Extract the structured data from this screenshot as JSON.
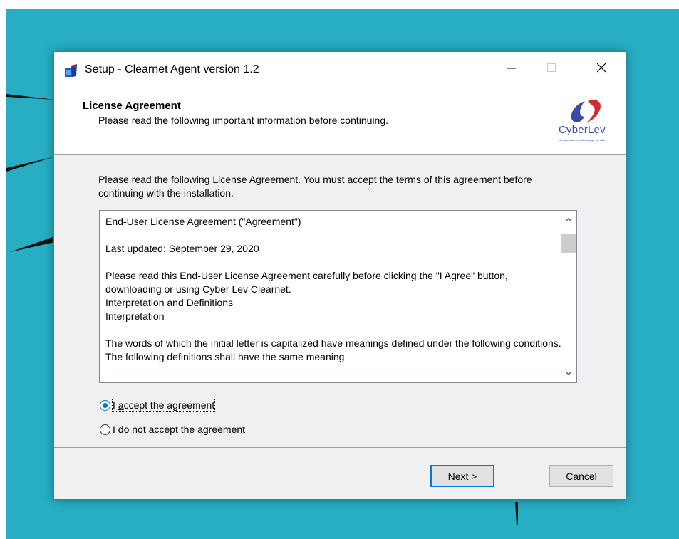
{
  "window": {
    "title": "Setup - Clearnet Agent version 1.2"
  },
  "header": {
    "title": "License Agreement",
    "subtitle": "Please read the following important information before continuing.",
    "logo_text": "CyberLev",
    "logo_tagline": "Identify, assess and manage the risk"
  },
  "instructions": "Please read the following License Agreement. You must accept the terms of this agreement before continuing with the installation.",
  "license": {
    "heading": "End-User License Agreement (\"Agreement\")",
    "updated": "Last updated: September 29, 2020",
    "para1": "Please read this End-User License Agreement carefully before clicking the \"I Agree\" button, downloading or using Cyber Lev Clearnet.",
    "line_interp_def": "Interpretation and Definitions",
    "line_interp": "Interpretation",
    "para2": "The words of which the initial letter is capitalized have meanings defined under the following conditions. The following definitions shall have the same meaning"
  },
  "options": {
    "accept": {
      "prefix": "I ",
      "mnemonic": "a",
      "rest": "ccept the agreement",
      "checked": true
    },
    "decline": {
      "prefix": "I ",
      "mnemonic": "d",
      "rest": "o not accept the agreement",
      "checked": false
    }
  },
  "buttons": {
    "next": {
      "mnemonic": "N",
      "rest": "ext >"
    },
    "cancel": "Cancel"
  },
  "colors": {
    "desktop": "#27aec3",
    "accent": "#0078d7",
    "logo_red": "#d7262e",
    "logo_blue": "#3a4aa8"
  }
}
